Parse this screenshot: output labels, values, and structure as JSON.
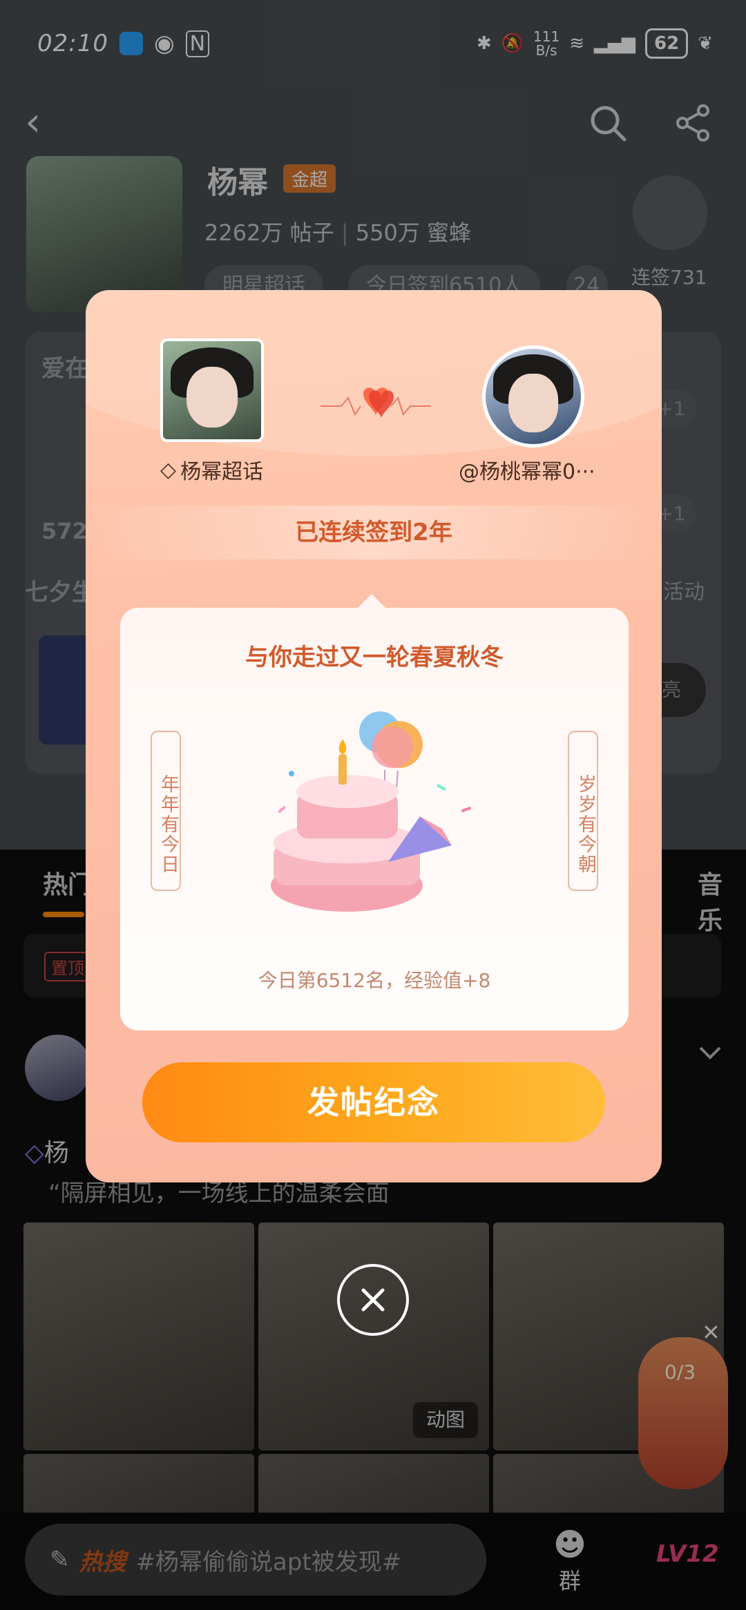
{
  "status_bar": {
    "time": "02:10",
    "net_speed": "111\nB/s",
    "battery": "62"
  },
  "header": {
    "name": "杨幂",
    "badge": "金超",
    "posts": "2262万",
    "posts_label": "帖子",
    "fans": "550万",
    "fans_label": "蜜蜂",
    "pills": [
      "明星超话",
      "今日签到6510人",
      "24"
    ],
    "streak": "连签731天"
  },
  "background": {
    "section1": "爱在",
    "section2": "七夕生",
    "activity": "活动",
    "members": "572人",
    "plus": "+1",
    "light": "亮",
    "tabs": [
      "热门",
      "音乐"
    ],
    "pinned_tag": "置顶",
    "post_user": "杨",
    "post_text": "“隔屏相见，一场线上的温柔会面",
    "gif_label": "动图",
    "task_count": "0/3",
    "hot_label": "热搜",
    "hot_text": "#杨幂偷偷说apt被发现#",
    "group_label": "群",
    "level": "LV12"
  },
  "modal": {
    "left_name": "杨幂超话",
    "right_name": "@杨桃幂幂0···",
    "streak_text": "已连续签到2年",
    "card_title": "与你走过又一轮春夏秋冬",
    "scroll_left": "年年有今日",
    "scroll_right": "岁岁有今朝",
    "rank_text": "今日第6512名，经验值+8",
    "post_button": "发帖纪念"
  },
  "colors": {
    "accent": "#ff8a14",
    "streak_text": "#d2592b",
    "modal_bg": "#fdc0a6"
  }
}
